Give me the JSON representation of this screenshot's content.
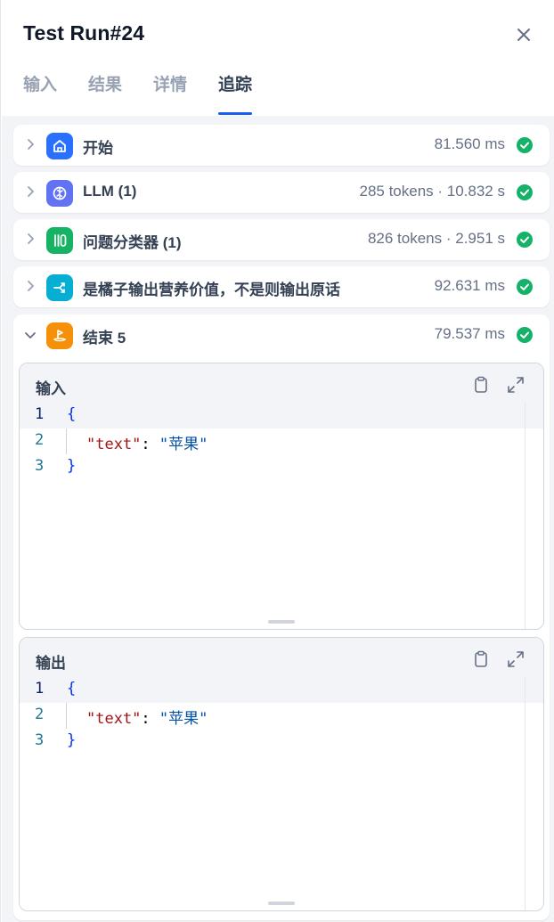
{
  "header": {
    "title": "Test Run#24",
    "tabs": [
      {
        "label": "输入"
      },
      {
        "label": "结果"
      },
      {
        "label": "详情"
      },
      {
        "label": "追踪"
      }
    ],
    "active_tab": "追踪"
  },
  "nodes": [
    {
      "label": "开始",
      "meta": "81.560 ms",
      "icon": "home-icon",
      "color": "#2970ff",
      "status": "success",
      "expanded": false
    },
    {
      "label": "LLM (1)",
      "meta": "285 tokens · 10.832 s",
      "icon": "brain-icon",
      "color": "#6172f3",
      "status": "success",
      "expanded": false
    },
    {
      "label": "问题分类器 (1)",
      "meta": "826 tokens · 2.951 s",
      "icon": "classifier-icon",
      "color": "#16b364",
      "status": "success",
      "expanded": false
    },
    {
      "label": "是橘子输出营养价值，不是则输出原话",
      "meta": "92.631 ms",
      "icon": "branch-icon",
      "color": "#06aed4",
      "status": "success",
      "expanded": false
    },
    {
      "label": "结束 5",
      "meta": "79.537 ms",
      "icon": "flag-icon",
      "color": "#f79009",
      "status": "success",
      "expanded": true
    }
  ],
  "input_panel": {
    "title": "输入",
    "lines": [
      "1",
      "2",
      "3"
    ],
    "key": "\"text\"",
    "value": "\"苹果\"",
    "open_brace": "{",
    "close_brace": "}",
    "colon": ": "
  },
  "output_panel": {
    "title": "输出",
    "lines": [
      "1",
      "2",
      "3"
    ],
    "key": "\"text\"",
    "value": "\"苹果\"",
    "open_brace": "{",
    "close_brace": "}",
    "colon": ": "
  },
  "colors": {
    "accent": "#155eef",
    "success": "#17b26a"
  }
}
